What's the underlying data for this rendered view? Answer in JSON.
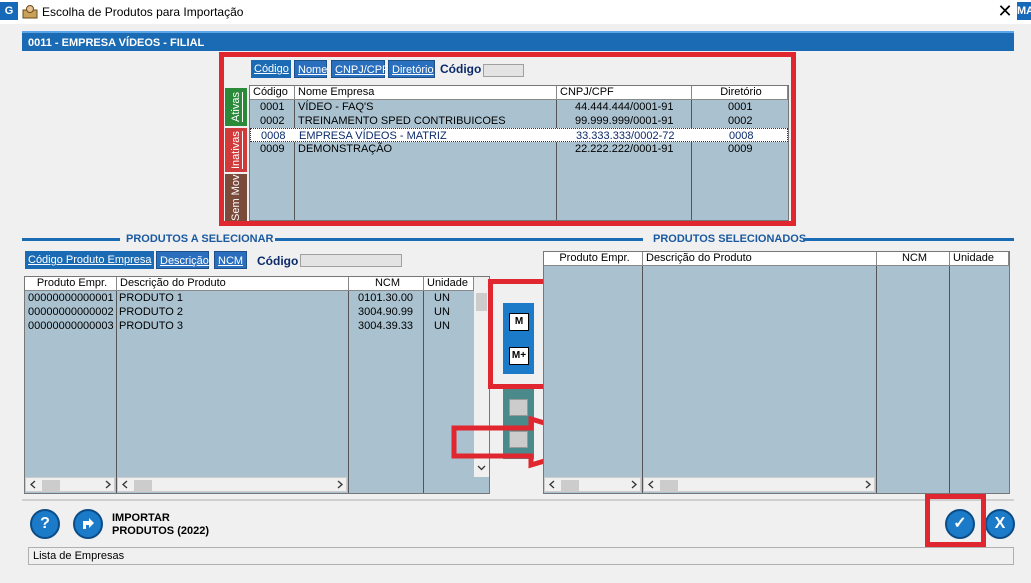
{
  "window": {
    "title": "Escolha de Produtos para Importação",
    "left_edge_label": "G",
    "right_edge_label": "MA",
    "close_glyph": "✕"
  },
  "header": {
    "company": "0011 - EMPRESA VÍDEOS - FILIAL"
  },
  "company_selector": {
    "tabs": [
      {
        "label": "Código"
      },
      {
        "label": "Nome"
      },
      {
        "label": "CNPJ/CPF"
      },
      {
        "label": "Diretório"
      }
    ],
    "search_label": "Código",
    "search_value": "",
    "side_tabs": [
      {
        "label": "Ativas",
        "color": "#2a8a3a"
      },
      {
        "label": "Inativas",
        "color": "#d03a3a"
      },
      {
        "label": "Sem Mov",
        "color": "#7a4a3a"
      }
    ],
    "columns": [
      "Código",
      "Nome Empresa",
      "CNPJ/CPF",
      "Diretório"
    ],
    "rows": [
      {
        "codigo": "0001",
        "nome": "VÍDEO - FAQ'S",
        "cnpj": "44.444.444/0001-91",
        "diretorio": "0001"
      },
      {
        "codigo": "0002",
        "nome": "TREINAMENTO SPED CONTRIBUICOES",
        "cnpj": "99.999.999/0001-91",
        "diretorio": "0002"
      },
      {
        "codigo": "0008",
        "nome": "EMPRESA VÍDEOS - MATRIZ",
        "cnpj": "33.333.333/0002-72",
        "diretorio": "0008"
      },
      {
        "codigo": "0009",
        "nome": "DEMONSTRAÇÃO",
        "cnpj": "22.222.222/0001-91",
        "diretorio": "0009"
      }
    ]
  },
  "products_to_select": {
    "title": "PRODUTOS A SELECIONAR",
    "tabs": [
      {
        "label": "Código Produto Empresa"
      },
      {
        "label": "Descrição"
      },
      {
        "label": "NCM"
      }
    ],
    "search_label": "Código",
    "search_value": "",
    "columns": [
      "Produto Empr.",
      "Descrição do Produto",
      "NCM",
      "Unidade"
    ],
    "rows": [
      {
        "produto": "00000000000001",
        "descricao": "PRODUTO 1",
        "ncm": "0101.30.00",
        "unidade": "UN"
      },
      {
        "produto": "00000000000002",
        "descricao": "PRODUTO 2",
        "ncm": "3004.90.99",
        "unidade": "UN"
      },
      {
        "produto": "00000000000003",
        "descricao": "PRODUTO 3",
        "ncm": "3004.39.33",
        "unidade": "UN"
      }
    ]
  },
  "transfer_buttons": {
    "mark_label": "M",
    "mark_all_label": "M+"
  },
  "products_selected": {
    "title": "PRODUTOS SELECIONADOS",
    "columns": [
      "Produto Empr.",
      "Descrição do Produto",
      "NCM",
      "Unidade"
    ],
    "rows": []
  },
  "footer": {
    "help_glyph": "?",
    "import_label_line1": "IMPORTAR",
    "import_label_line2": "PRODUTOS (2022)",
    "confirm_glyph": "✓",
    "cancel_glyph": "X"
  },
  "status_bar": {
    "text": "Lista de Empresas"
  },
  "colors": {
    "accent": "#1b6bb4",
    "grid_bg": "#aac1cf",
    "annotation_red": "#e0262e"
  }
}
